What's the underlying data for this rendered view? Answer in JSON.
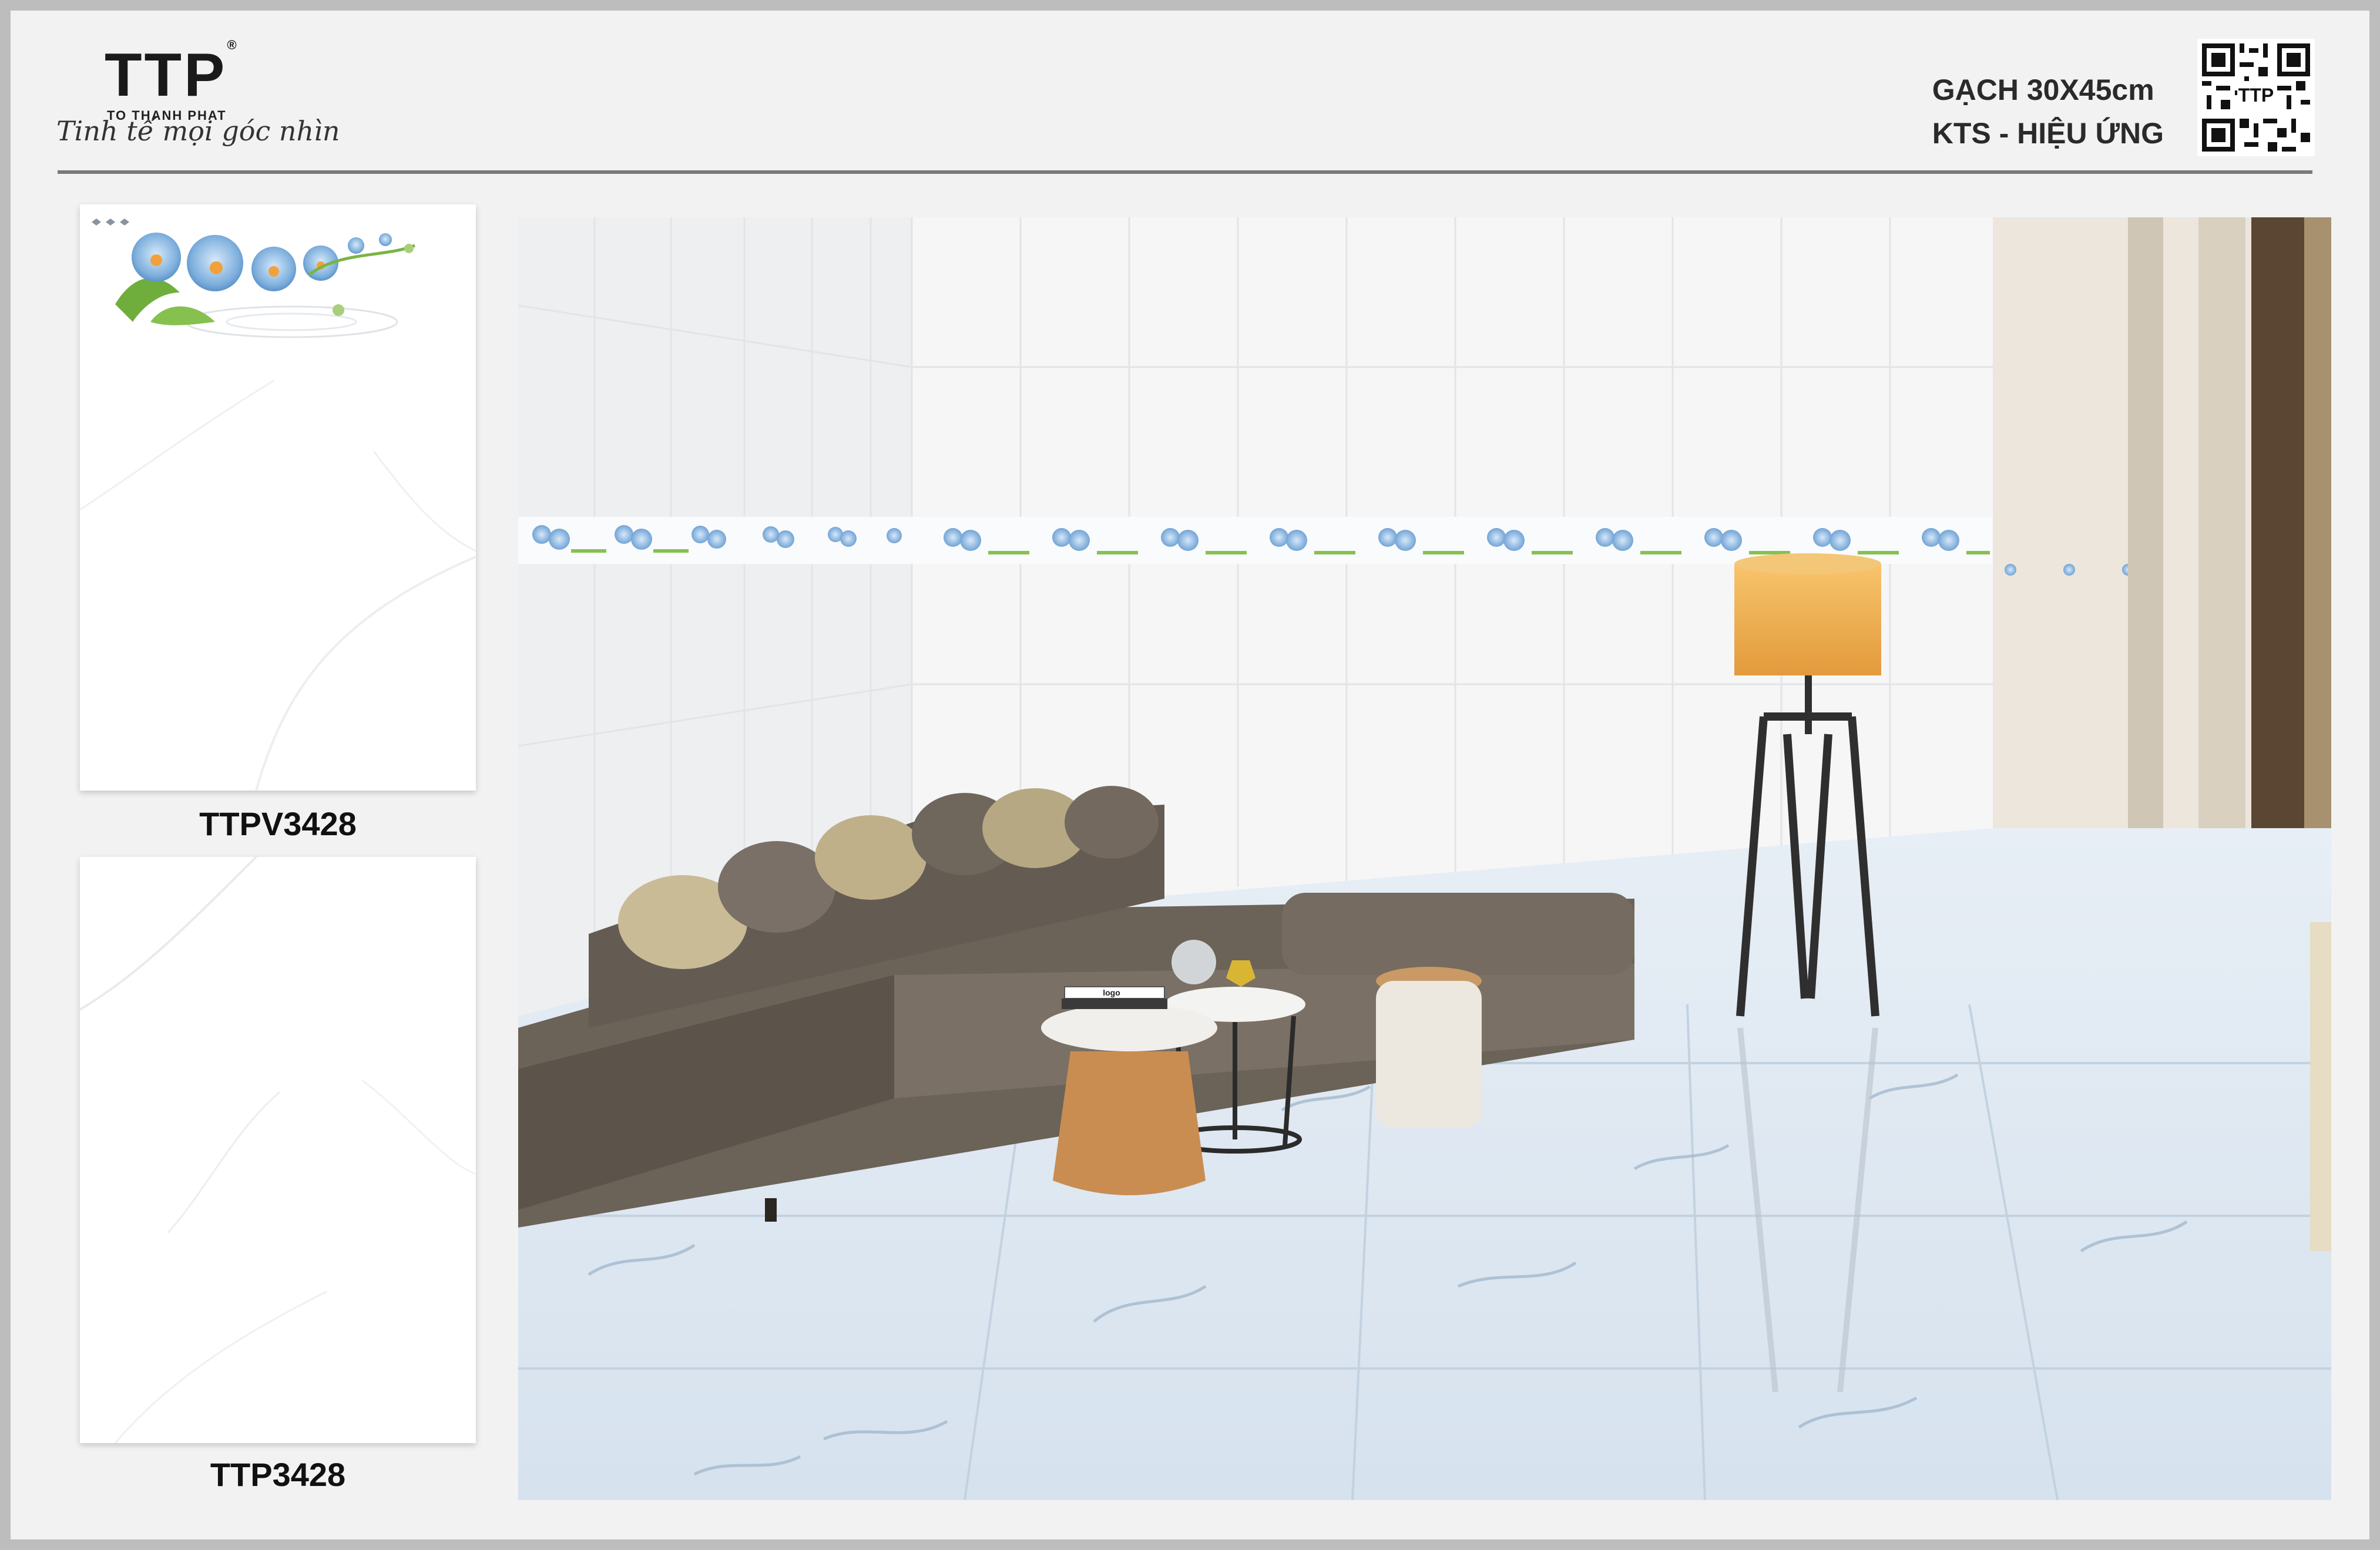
{
  "brand": {
    "logo": "TTP",
    "registered": "®",
    "sub": "TO THANH PHAT",
    "slogan": "Tinh tế mọi góc nhìn"
  },
  "header": {
    "product_line": "GẠCH 30X45cm",
    "subtitle": "KTS - HIỆU ỨNG"
  },
  "qr": {
    "label": "TTP"
  },
  "swatches": [
    {
      "code": "TTPV3428"
    },
    {
      "code": "TTP3428"
    }
  ],
  "scene": {
    "book_label": "logo"
  },
  "colors": {
    "background": "#f2f2f2",
    "frame": "#bdbdbd",
    "sofa": "#6b6258",
    "orchid": "#7fb0dd",
    "lamp_shade": "#f0a446"
  }
}
